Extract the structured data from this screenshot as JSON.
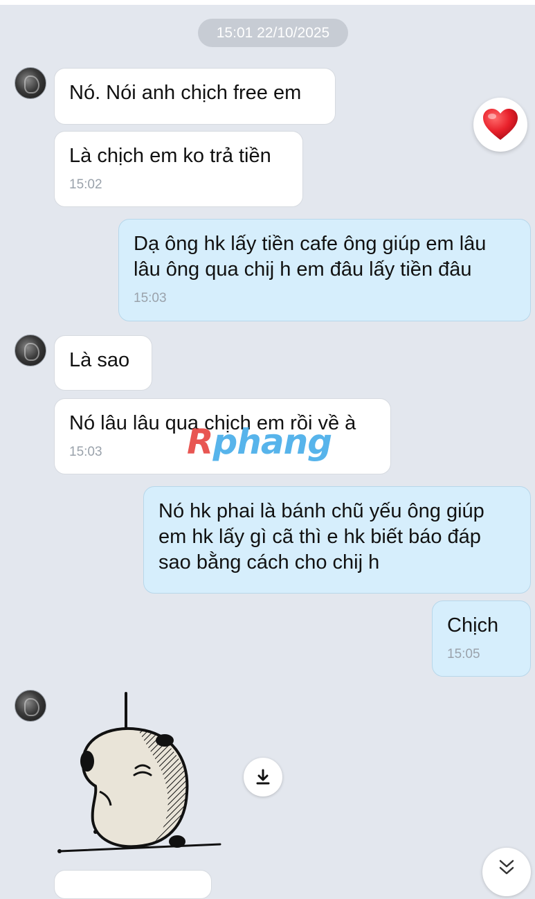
{
  "date_separator": "15:01 22/10/2025",
  "messages": [
    {
      "text": "Nó. Nói anh chịch free em",
      "time": ""
    },
    {
      "text": "Là chịch em ko trả tiền",
      "time": "15:02"
    },
    {
      "text": "Dạ ông hk lấy tiền cafe ông giúp em lâu lâu ông qua chij h em đâu lấy tiền đâu",
      "time": "15:03"
    },
    {
      "text": "Là sao",
      "time": ""
    },
    {
      "text": "Nó lâu lâu qua chịch em rồi về à",
      "time": "15:03"
    },
    {
      "text": "Nó hk phai là bánh chũ yếu ông giúp em hk lấy gì cã thì e hk biết báo đáp sao bằng cách cho chij h",
      "time": ""
    },
    {
      "text": "Chịch",
      "time": "15:05"
    }
  ],
  "reaction": {
    "icon": "heart-icon",
    "color": "#e8212b"
  },
  "sticker": {
    "icon": "capybara-sticker"
  },
  "watermark": {
    "part1": "R",
    "part2": "phang"
  },
  "buttons": {
    "download_icon": "download-icon",
    "scroll_icon": "double-chevron-down-icon"
  }
}
